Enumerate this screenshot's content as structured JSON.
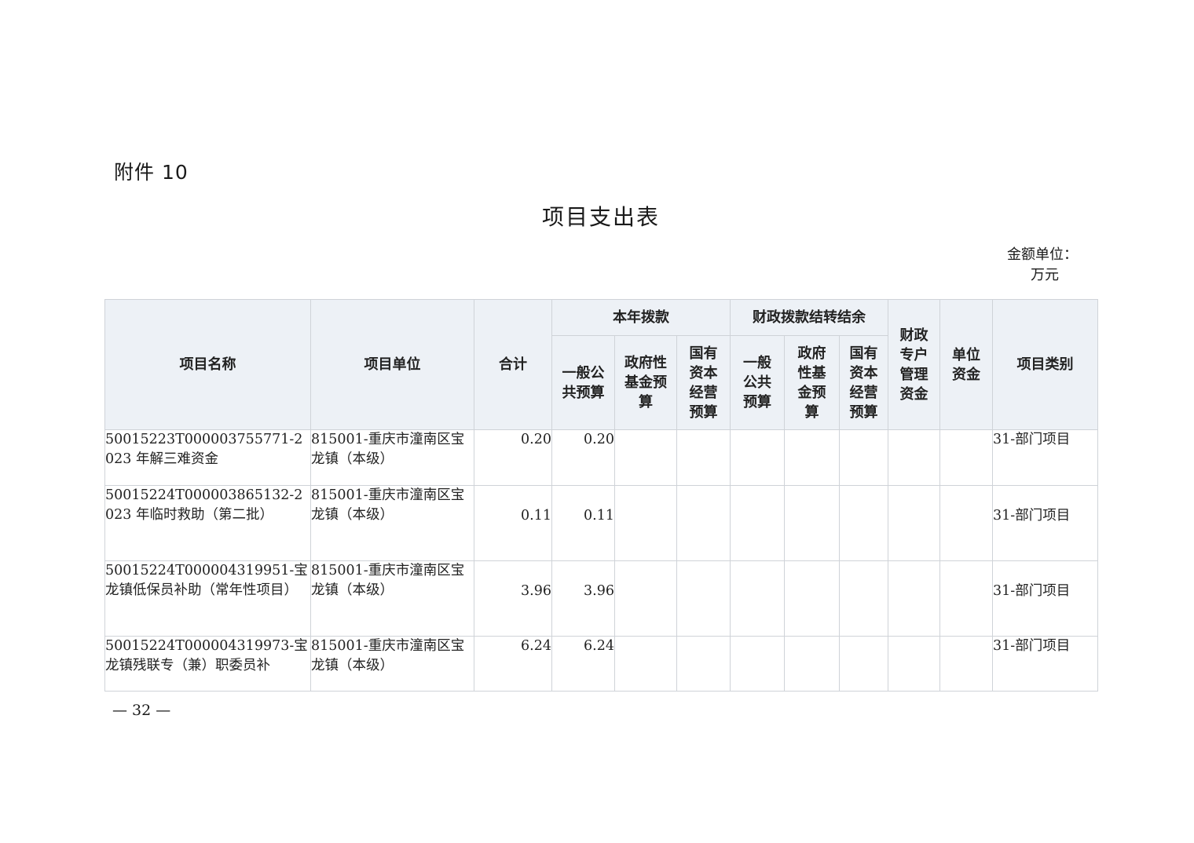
{
  "attachment_label": "附件 10",
  "title": "项目支出表",
  "unit_line1": "金额单位：",
  "unit_line2": "万元",
  "headers": {
    "project_name": "项目名称",
    "project_unit": "项目单位",
    "total": "合计",
    "current_year": "本年拨款",
    "carryover": "财政拨款结转结余",
    "general_public": "一般公共预算",
    "gov_fund": "政府性基金预算",
    "state_capital": "国有资本经营预算",
    "general_public_short": "一般公共预算",
    "gov_fund_short": "政府性基金预算",
    "state_capital_short": "国有资本经营预算",
    "special_fund": "财政专户管理资金",
    "unit_fund": "单位资金",
    "category": "项目类别"
  },
  "rows": [
    {
      "name": "50015223T000003755771-2023 年解三难资金",
      "unit": "815001-重庆市潼南区宝龙镇（本级）",
      "total": "0.20",
      "general": "0.20",
      "category": "31-部门项目"
    },
    {
      "name": "50015224T000003865132-2023 年临时救助（第二批）",
      "unit": "815001-重庆市潼南区宝龙镇（本级）",
      "total": "0.11",
      "general": "0.11",
      "category": "31-部门项目"
    },
    {
      "name": "50015224T000004319951-宝龙镇低保员补助（常年性项目）",
      "unit": "815001-重庆市潼南区宝龙镇（本级）",
      "total": "3.96",
      "general": "3.96",
      "category": "31-部门项目"
    },
    {
      "name": "50015224T000004319973-宝龙镇残联专（兼）职委员补",
      "unit": "815001-重庆市潼南区宝龙镇（本级）",
      "total": "6.24",
      "general": "6.24",
      "category": "31-部门项目"
    }
  ],
  "page_number": "— 32 —"
}
